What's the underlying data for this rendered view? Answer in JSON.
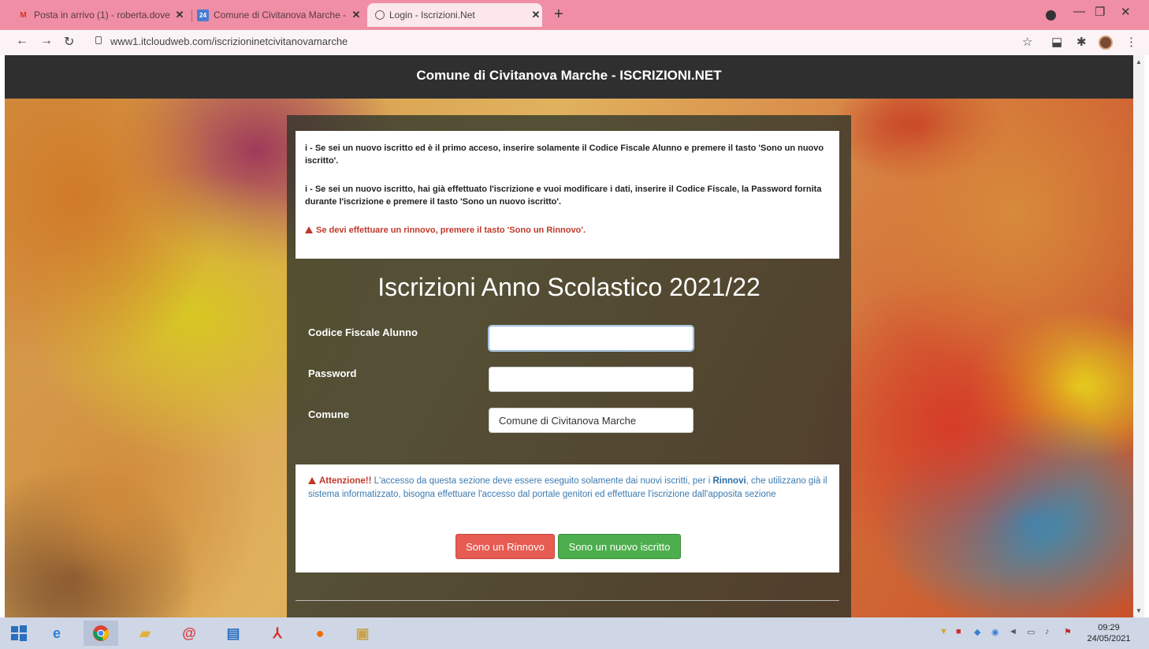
{
  "browser": {
    "tabs": [
      {
        "title": "Posta in arrivo (1) - roberta.dove"
      },
      {
        "title": "Comune di Civitanova Marche -"
      },
      {
        "title": "Login - Iscrizioni.Net"
      }
    ],
    "favicon_calendar_text": "24",
    "url": "www1.itcloudweb.com/iscrizioninetcivitanovamarche"
  },
  "page": {
    "header_title": "Comune di Civitanova Marche - ISCRIZIONI.NET",
    "info": {
      "line1": "i - Se sei un nuovo iscritto ed è il primo acceso, inserire solamente il Codice Fiscale Alunno e premere il tasto 'Sono un nuovo iscritto'.",
      "line2": "i - Se sei un nuovo iscritto, hai già effettuato l'iscrizione e vuoi modificare i dati, inserire il Codice Fiscale, la Password fornita durante l'iscrizione e premere il tasto 'Sono un nuovo iscritto'.",
      "warning": "Se devi effettuare un rinnovo, premere il tasto 'Sono un Rinnovo'."
    },
    "form_title": "Iscrizioni Anno Scolastico 2021/22",
    "fields": {
      "codice_label": "Codice Fiscale Alunno",
      "codice_value": "",
      "password_label": "Password",
      "password_value": "",
      "comune_label": "Comune",
      "comune_value": "Comune di Civitanova Marche"
    },
    "attention": {
      "heading": "Attenzione!!",
      "text_before": " L'accesso da questa sezione deve essere eseguito solamente dai nuovi iscritti, per i ",
      "emphasis": "Rinnovi",
      "text_after": ", che utilizzano già il sistema informatizzato, bisogna effettuare l'accesso dal portale genitori ed effettuare l'iscrizione dall'apposita sezione"
    },
    "buttons": {
      "rinnovo": "Sono un Rinnovo",
      "nuovo": "Sono un nuovo iscritto"
    }
  },
  "taskbar": {
    "time": "09:29",
    "date": "24/05/2021"
  },
  "colors": {
    "tabstrip": "#ef8ea4",
    "header": "#2f2f2f",
    "warning_red": "#c0392b",
    "button_red": "#e65b52",
    "button_green": "#4cae4c",
    "info_blue": "#3b7ab0"
  }
}
